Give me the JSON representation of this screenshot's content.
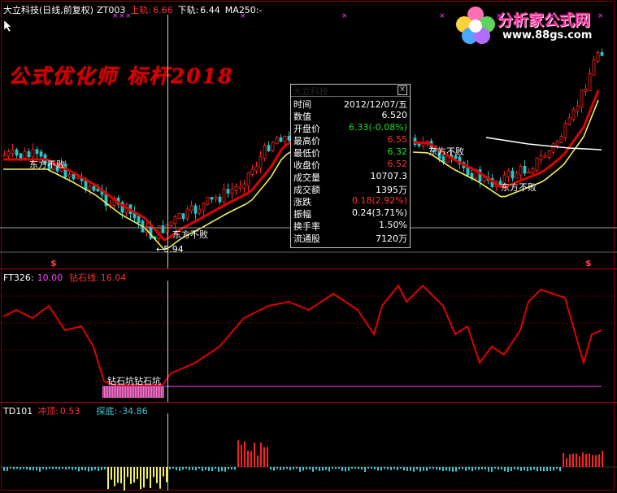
{
  "header": {
    "title": "大立科技(日线,前复权)",
    "indicator": "ZT003",
    "upper_label": "上轨:",
    "upper_value": "6.66",
    "lower_label": "下轨:",
    "lower_value": "6.44",
    "ma_label": "MA250:",
    "ma_value": "-"
  },
  "watermark": "公式优化师  标杆2018",
  "logo": {
    "title": "分析家公式网",
    "url": "www.88gs.com"
  },
  "price_labels": {
    "low_price": "←5.94",
    "label_a": "东方不败",
    "label_b": "东方不败",
    "label_c": "东方不败",
    "label_d": "东方不败"
  },
  "markers": {
    "s1": "$",
    "s2": "$"
  },
  "popup": {
    "title": "大立科技",
    "rows": [
      {
        "label": "时间",
        "value": "2012/12/07/五",
        "color": "#ffffff"
      },
      {
        "label": "数值",
        "value": "6.520",
        "color": "#ffffff"
      },
      {
        "label": "开盘价",
        "value": "6.33(-0.08%)",
        "color": "#22dd22"
      },
      {
        "label": "最高价",
        "value": "6.55",
        "color": "#ff3333"
      },
      {
        "label": "最低价",
        "value": "6.32",
        "color": "#22dd22"
      },
      {
        "label": "收盘价",
        "value": "6.52",
        "color": "#ff3333"
      },
      {
        "label": "成交量",
        "value": "10707.3",
        "color": "#ffffff"
      },
      {
        "label": "成交额",
        "value": "1395万",
        "color": "#ffffff"
      },
      {
        "label": "涨跌",
        "value": "0.18(2.92%)",
        "color": "#ff3333"
      },
      {
        "label": "振幅",
        "value": "0.24(3.71%)",
        "color": "#ffffff"
      },
      {
        "label": "换手率",
        "value": "1.50%",
        "color": "#ffffff"
      },
      {
        "label": "流通股",
        "value": "7120万",
        "color": "#ffffff"
      }
    ]
  },
  "panel2": {
    "name": "FT326",
    "value_label": ":",
    "value": "10.00",
    "line_label": "钻石线:",
    "line_value": "16.04",
    "zone_label": "钻石坑钻石坑"
  },
  "panel3": {
    "name": "TD101",
    "top_label": "冲顶:",
    "top_value": "0.53",
    "bottom_label": "探底:",
    "bottom_value": "-34.86"
  },
  "colors": {
    "up": "#ff2020",
    "down": "#22c8c8",
    "ma_red": "#e00000",
    "ma_yellow": "#f0f060",
    "magenta": "#ff40ff",
    "panel_line": "#e00000",
    "bar_yellow": "#f0f060",
    "bar_cyan": "#40c8d0"
  }
}
